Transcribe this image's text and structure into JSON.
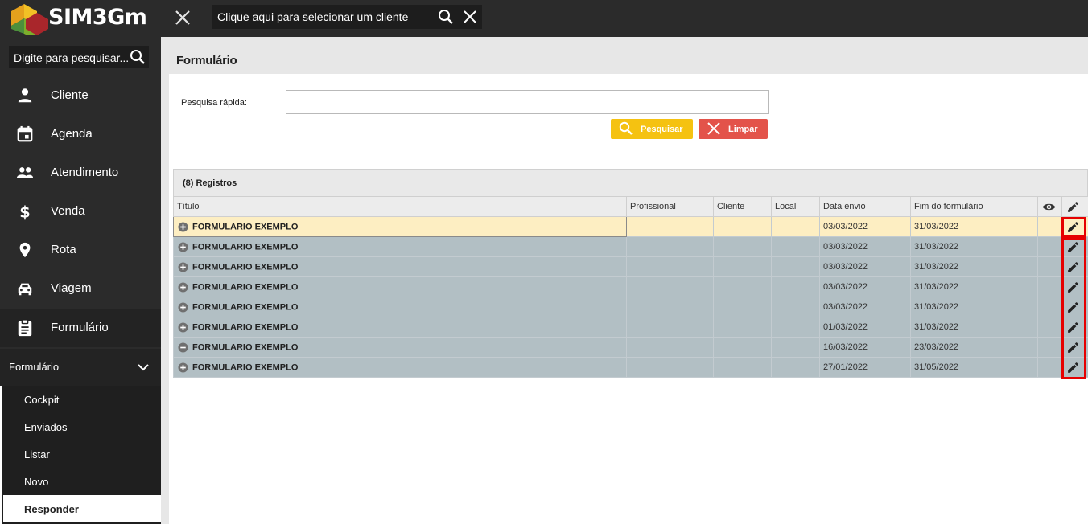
{
  "app": {
    "brand": "SIM3Gm"
  },
  "topbar": {
    "client_placeholder": "Clique aqui para selecionar um cliente"
  },
  "sidebar": {
    "search_placeholder": "Digite para pesquisar...",
    "items": [
      {
        "label": "Cliente",
        "icon": "person-icon"
      },
      {
        "label": "Agenda",
        "icon": "calendar-icon"
      },
      {
        "label": "Atendimento",
        "icon": "people-icon"
      },
      {
        "label": "Venda",
        "icon": "dollar-icon"
      },
      {
        "label": "Rota",
        "icon": "pin-icon"
      },
      {
        "label": "Viagem",
        "icon": "car-icon"
      },
      {
        "label": "Formulário",
        "icon": "clipboard-icon"
      }
    ],
    "submenu_title": "Formulário",
    "submenu": [
      "Cockpit",
      "Enviados",
      "Listar",
      "Novo",
      "Responder"
    ]
  },
  "page": {
    "title": "Formulário",
    "quick_search_label": "Pesquisa rápida:",
    "search_button": "Pesquisar",
    "clear_button": "Limpar"
  },
  "grid": {
    "caption": "(8) Registros",
    "columns": [
      "Título",
      "Profissional",
      "Cliente",
      "Local",
      "Data envio",
      "Fim do formulário"
    ],
    "rows": [
      {
        "expand": "plus",
        "titulo": "FORMULARIO EXEMPLO",
        "profissional": "",
        "cliente": "",
        "local": "",
        "data_envio": "03/03/2022",
        "fim": "31/03/2022"
      },
      {
        "expand": "plus",
        "titulo": "FORMULARIO EXEMPLO",
        "profissional": "",
        "cliente": "",
        "local": "",
        "data_envio": "03/03/2022",
        "fim": "31/03/2022"
      },
      {
        "expand": "plus",
        "titulo": "FORMULARIO EXEMPLO",
        "profissional": "",
        "cliente": "",
        "local": "",
        "data_envio": "03/03/2022",
        "fim": "31/03/2022"
      },
      {
        "expand": "plus",
        "titulo": "FORMULARIO EXEMPLO",
        "profissional": "",
        "cliente": "",
        "local": "",
        "data_envio": "03/03/2022",
        "fim": "31/03/2022"
      },
      {
        "expand": "plus",
        "titulo": "FORMULARIO EXEMPLO",
        "profissional": "",
        "cliente": "",
        "local": "",
        "data_envio": "03/03/2022",
        "fim": "31/03/2022"
      },
      {
        "expand": "plus",
        "titulo": "FORMULARIO EXEMPLO",
        "profissional": "",
        "cliente": "",
        "local": "",
        "data_envio": "01/03/2022",
        "fim": "31/03/2022"
      },
      {
        "expand": "minus",
        "titulo": "FORMULARIO EXEMPLO",
        "profissional": "",
        "cliente": "",
        "local": "",
        "data_envio": "16/03/2022",
        "fim": "23/03/2022"
      },
      {
        "expand": "plus",
        "titulo": "FORMULARIO EXEMPLO",
        "profissional": "",
        "cliente": "",
        "local": "",
        "data_envio": "27/01/2022",
        "fim": "31/05/2022"
      }
    ]
  },
  "colors": {
    "topbar": "#2b2b2b",
    "search_button": "#f5c211",
    "clear_button": "#e3534a",
    "row_bg": "#b2bfc4",
    "row_selected": "#fdeec2",
    "highlight": "#e60000"
  }
}
